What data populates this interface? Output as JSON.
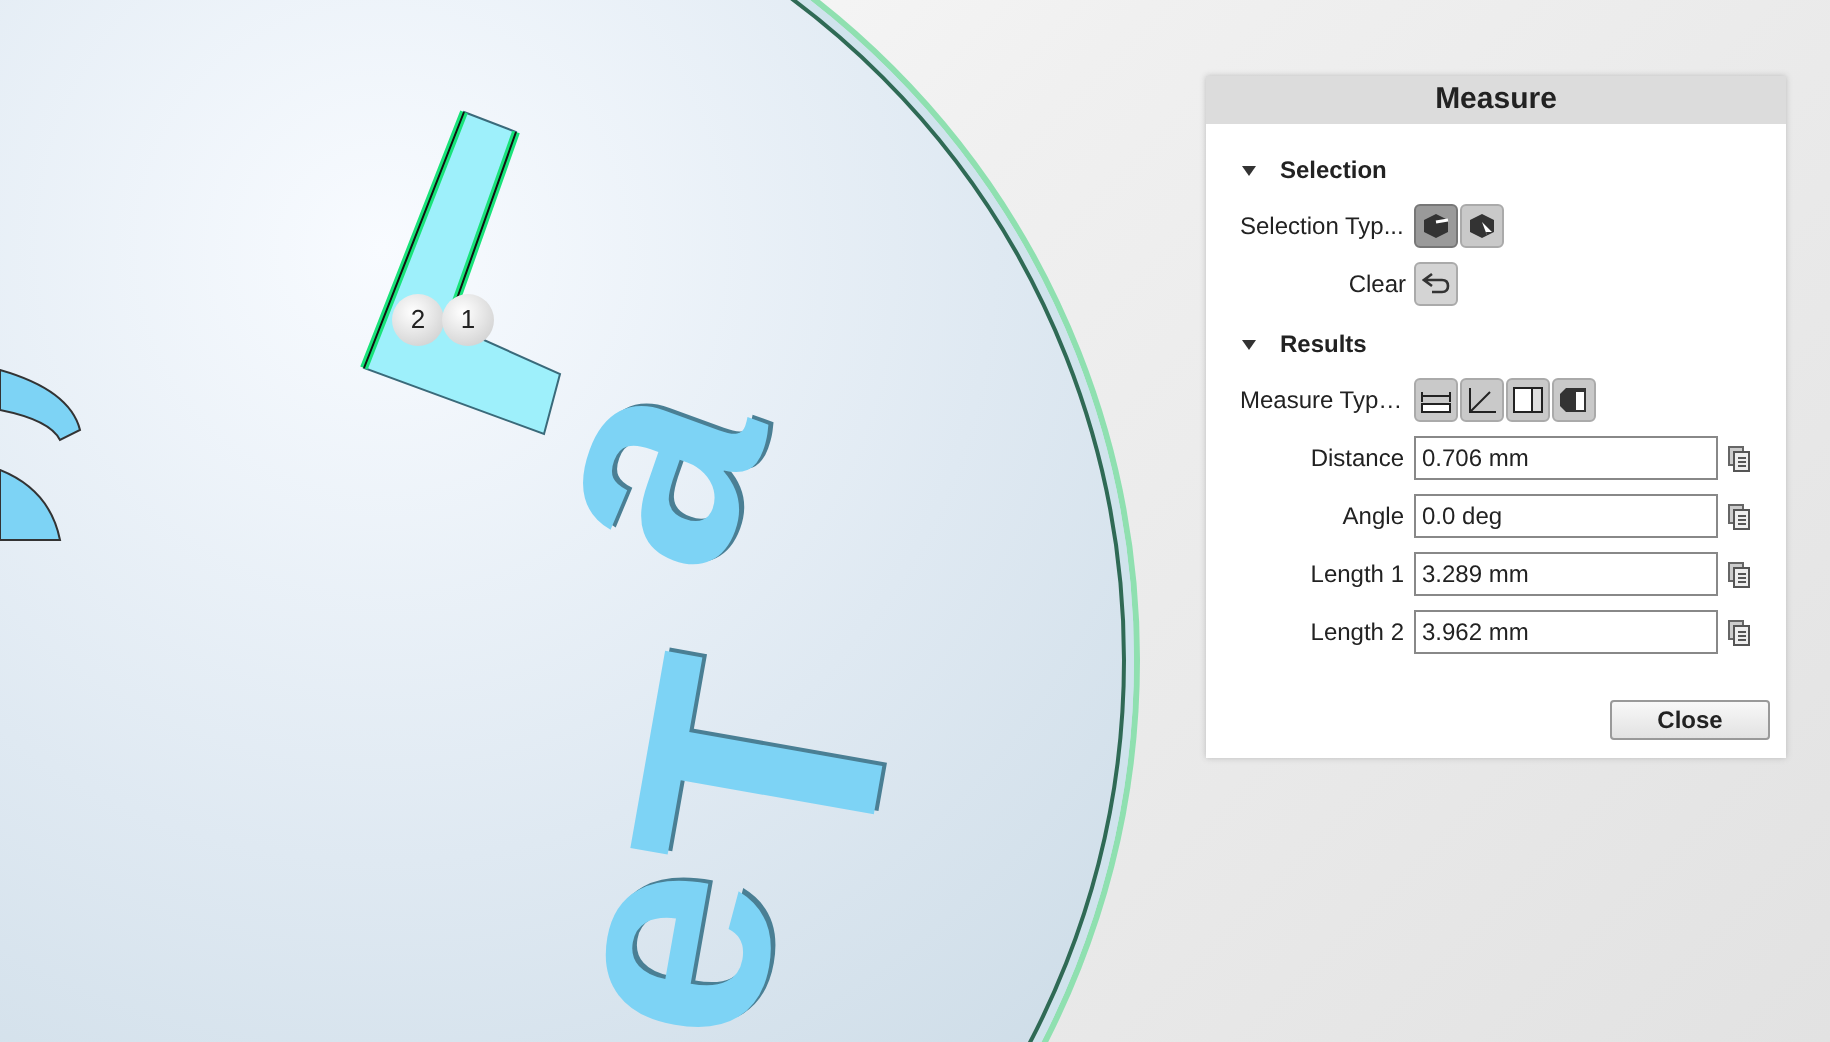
{
  "viewport": {
    "letters": [
      "a",
      "T",
      "e"
    ],
    "markers": [
      "2",
      "1"
    ]
  },
  "panel": {
    "title": "Measure",
    "selection": {
      "heading": "Selection",
      "expanded": true,
      "type_label": "Selection Typ...",
      "types": [
        {
          "kind": "cube",
          "selected": true
        },
        {
          "kind": "arrow",
          "selected": false
        }
      ],
      "clear_label": "Clear"
    },
    "results": {
      "heading": "Results",
      "expanded": true,
      "type_label": "Measure Typ…",
      "types": [
        {
          "kind": "distance"
        },
        {
          "kind": "angle"
        },
        {
          "kind": "length"
        },
        {
          "kind": "volume"
        }
      ],
      "fields": [
        {
          "label": "Distance",
          "value": "0.706 mm"
        },
        {
          "label": "Angle",
          "value": "0.0 deg"
        },
        {
          "label": "Length 1",
          "value": "3.289 mm"
        },
        {
          "label": "Length 2",
          "value": "3.962 mm"
        }
      ]
    },
    "close_button": "Close"
  }
}
